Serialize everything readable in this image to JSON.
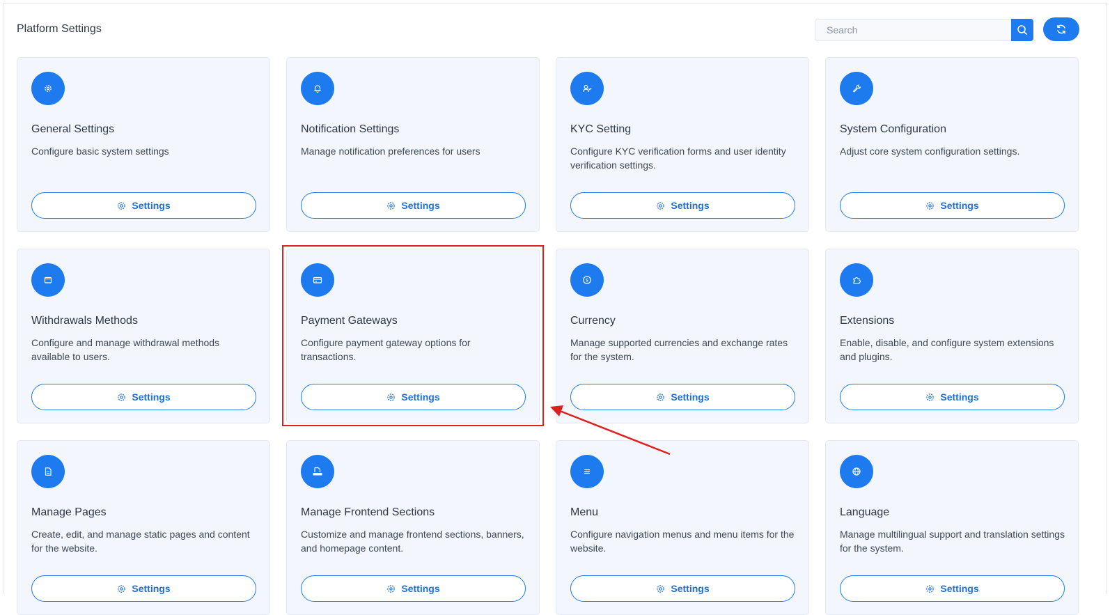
{
  "header": {
    "title": "Platform Settings",
    "search_placeholder": "Search",
    "search_icon": "search-icon",
    "refresh_icon": "refresh-icon"
  },
  "colors": {
    "accent": "#1d7bef",
    "card_bg": "#f3f7fd",
    "highlight": "#e0201f"
  },
  "cards": [
    {
      "title": "General Settings",
      "desc": "Configure basic system settings",
      "icon": "gear-icon",
      "button": "Settings"
    },
    {
      "title": "Notification Settings",
      "desc": "Manage notification preferences for users",
      "icon": "bell-icon",
      "button": "Settings"
    },
    {
      "title": "KYC Setting",
      "desc": "Configure KYC verification forms and user identity verification settings.",
      "icon": "user-check-icon",
      "button": "Settings"
    },
    {
      "title": "System Configuration",
      "desc": "Adjust core system configuration settings.",
      "icon": "wrench-icon",
      "button": "Settings"
    },
    {
      "title": "Withdrawals Methods",
      "desc": "Configure and manage withdrawal methods available to users.",
      "icon": "wallet-icon",
      "button": "Settings"
    },
    {
      "title": "Payment Gateways",
      "desc": "Configure payment gateway options for transactions.",
      "icon": "credit-card-icon",
      "button": "Settings"
    },
    {
      "title": "Currency",
      "desc": "Manage supported currencies and exchange rates for the system.",
      "icon": "dollar-circle-icon",
      "button": "Settings"
    },
    {
      "title": "Extensions",
      "desc": "Enable, disable, and configure system extensions and plugins.",
      "icon": "puzzle-icon",
      "button": "Settings"
    },
    {
      "title": "Manage Pages",
      "desc": "Create, edit, and manage static pages and content for the website.",
      "icon": "file-icon",
      "button": "Settings"
    },
    {
      "title": "Manage Frontend Sections",
      "desc": "Customize and manage frontend sections, banners, and homepage content.",
      "icon": "html-file-icon",
      "button": "Settings"
    },
    {
      "title": "Menu",
      "desc": "Configure navigation menus and menu items for the website.",
      "icon": "menu-icon",
      "button": "Settings"
    },
    {
      "title": "Language",
      "desc": "Manage multilingual support and translation settings for the system.",
      "icon": "globe-icon",
      "button": "Settings"
    }
  ]
}
